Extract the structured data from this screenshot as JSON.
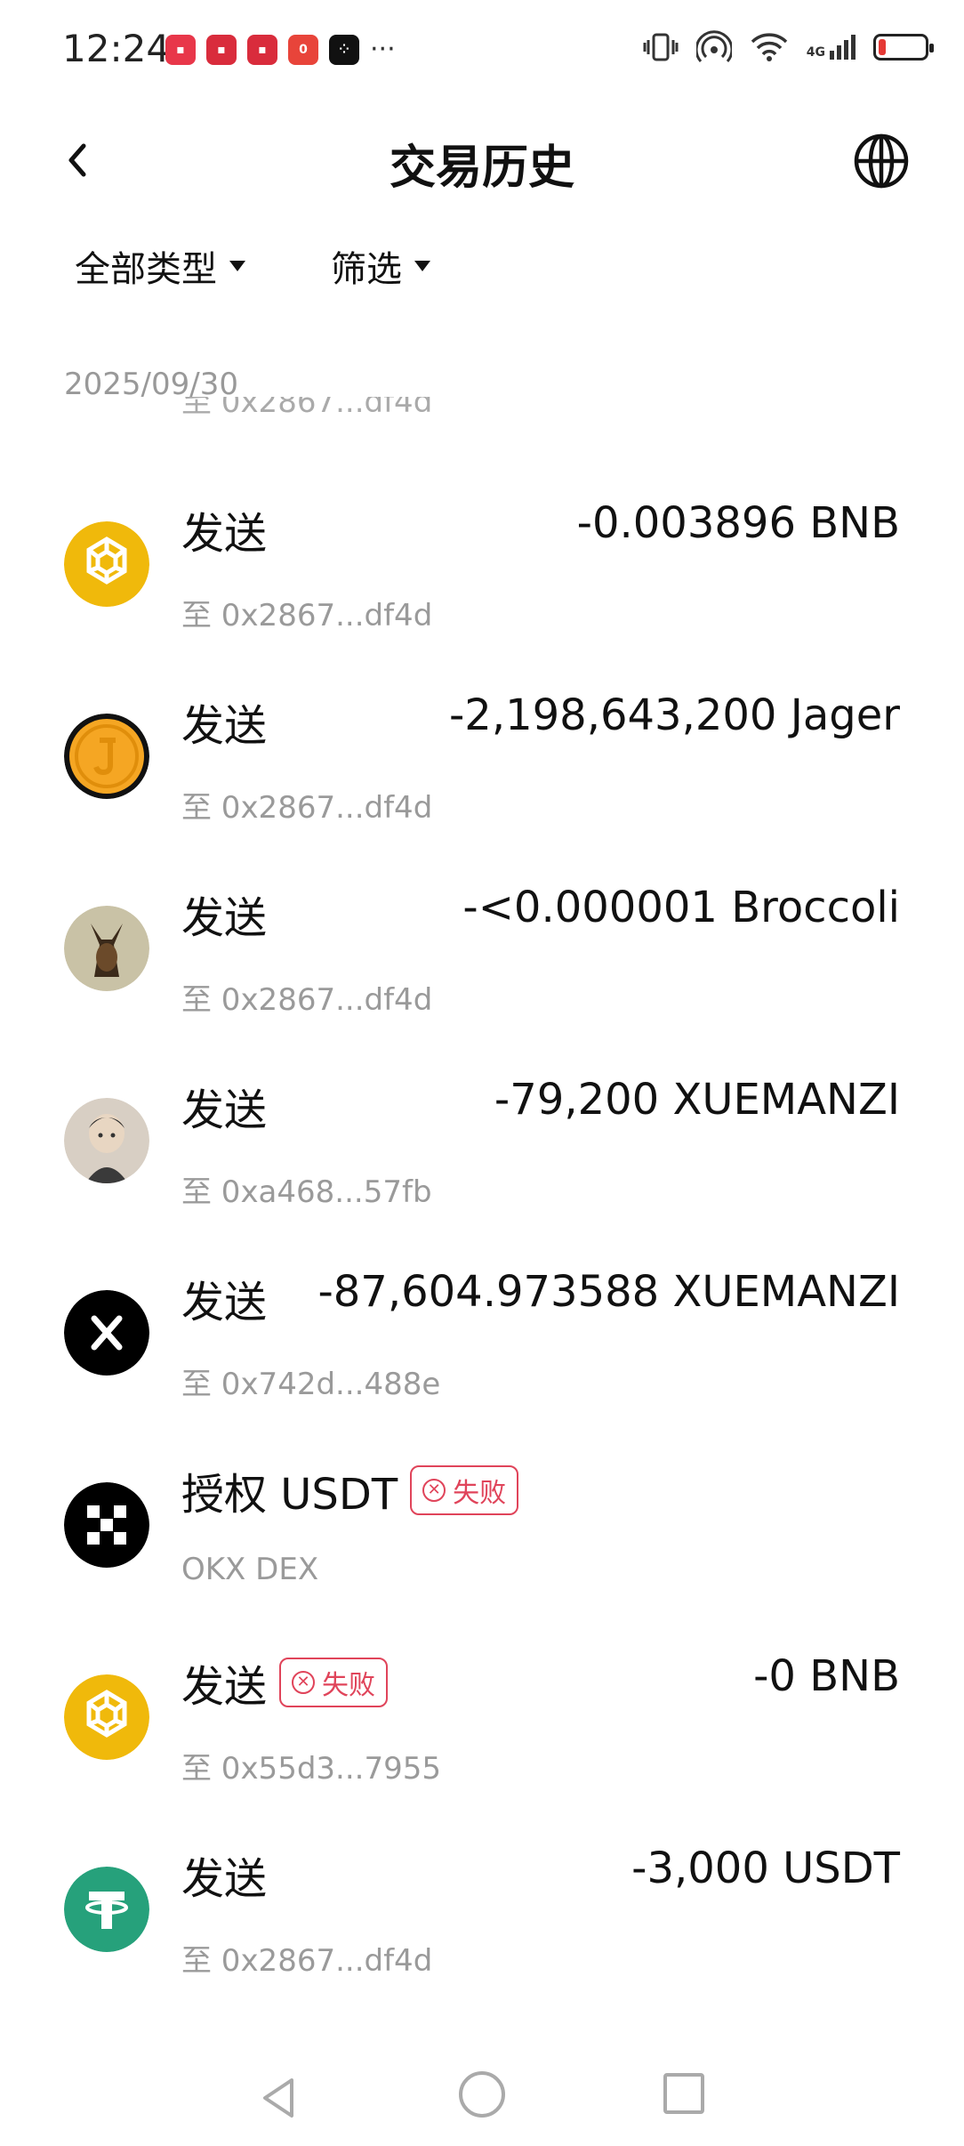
{
  "status_bar": {
    "time": "12:24",
    "more": "···",
    "battery_level": 0.15,
    "network": "4G"
  },
  "header": {
    "title": "交易历史"
  },
  "filters": {
    "type_label": "全部类型",
    "filter_label": "筛选"
  },
  "date_group": "2025/09/30",
  "partial_row_sub": "至 0x2867...df4d",
  "transactions": [
    {
      "type": "发送",
      "sub": "至 0x2867...df4d",
      "amount": "-0.003896 BNB",
      "icon": "bnb-icon",
      "status": ""
    },
    {
      "type": "发送",
      "sub": "至 0x2867...df4d",
      "amount": "-2,198,643,200 Jager",
      "icon": "jager-token-icon",
      "status": ""
    },
    {
      "type": "发送",
      "sub": "至 0x2867...df4d",
      "amount": "-<0.000001 Broccoli",
      "icon": "broccoli-token-icon",
      "status": ""
    },
    {
      "type": "发送",
      "sub": "至 0xa468...57fb",
      "amount": "-79,200 XUEMANZI",
      "icon": "xuemanzi-token-icon",
      "status": ""
    },
    {
      "type": "发送",
      "sub": "至 0x742d...488e",
      "amount": "-87,604.973588 XUEMANZI",
      "icon": "x-token-icon",
      "status": ""
    },
    {
      "type": "授权 USDT",
      "sub": "OKX DEX",
      "amount": "",
      "icon": "okx-icon",
      "status": "失败"
    },
    {
      "type": "发送",
      "sub": "至 0x55d3...7955",
      "amount": "-0 BNB",
      "icon": "bnb-icon",
      "status": "失败"
    },
    {
      "type": "发送",
      "sub": "至 0x2867...df4d",
      "amount": "-3,000 USDT",
      "icon": "usdt-icon",
      "status": ""
    }
  ],
  "colors": {
    "bnb": "#F0B90B",
    "usdt": "#26A17B",
    "fail": "#E0445A",
    "muted": "#9A9A9A"
  }
}
